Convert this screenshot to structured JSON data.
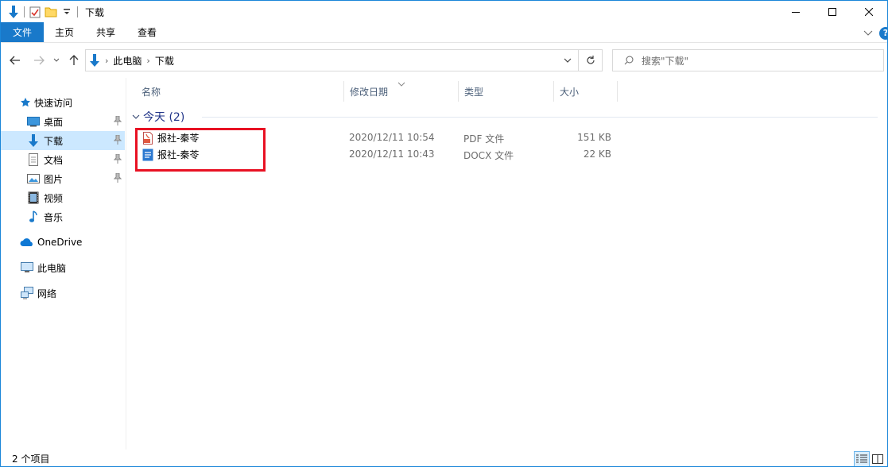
{
  "window": {
    "title": "下载",
    "controls": {
      "minimize": "—",
      "maximize": "☐",
      "close": "✕"
    }
  },
  "ribbon": {
    "tabs": [
      "文件",
      "主页",
      "共享",
      "查看"
    ],
    "help": "?"
  },
  "address": {
    "crumbs": [
      "此电脑",
      "下载"
    ],
    "search_placeholder": "搜索\"下载\""
  },
  "nav": {
    "quick_access": "快速访问",
    "items": [
      {
        "label": "桌面",
        "pinned": true
      },
      {
        "label": "下载",
        "pinned": true,
        "selected": true
      },
      {
        "label": "文档",
        "pinned": true
      },
      {
        "label": "图片",
        "pinned": true
      },
      {
        "label": "视频",
        "pinned": false
      },
      {
        "label": "音乐",
        "pinned": false
      }
    ],
    "onedrive": "OneDrive",
    "this_pc": "此电脑",
    "network": "网络"
  },
  "columns": {
    "name": "名称",
    "date": "修改日期",
    "type": "类型",
    "size": "大小"
  },
  "group": {
    "label": "今天 (2)"
  },
  "files": [
    {
      "name": "报社-秦苓",
      "date": "2020/12/11 10:54",
      "type": "PDF 文件",
      "size": "151 KB",
      "icon": "pdf-icon"
    },
    {
      "name": "报社-秦苓",
      "date": "2020/12/11 10:43",
      "type": "DOCX 文件",
      "size": "22 KB",
      "icon": "docx-icon"
    }
  ],
  "status": {
    "count": "2 个项目"
  },
  "colors": {
    "accent": "#1979ca",
    "selected_bg": "#cce8ff",
    "highlight_border": "#e81123",
    "group_text": "#1e3287"
  }
}
